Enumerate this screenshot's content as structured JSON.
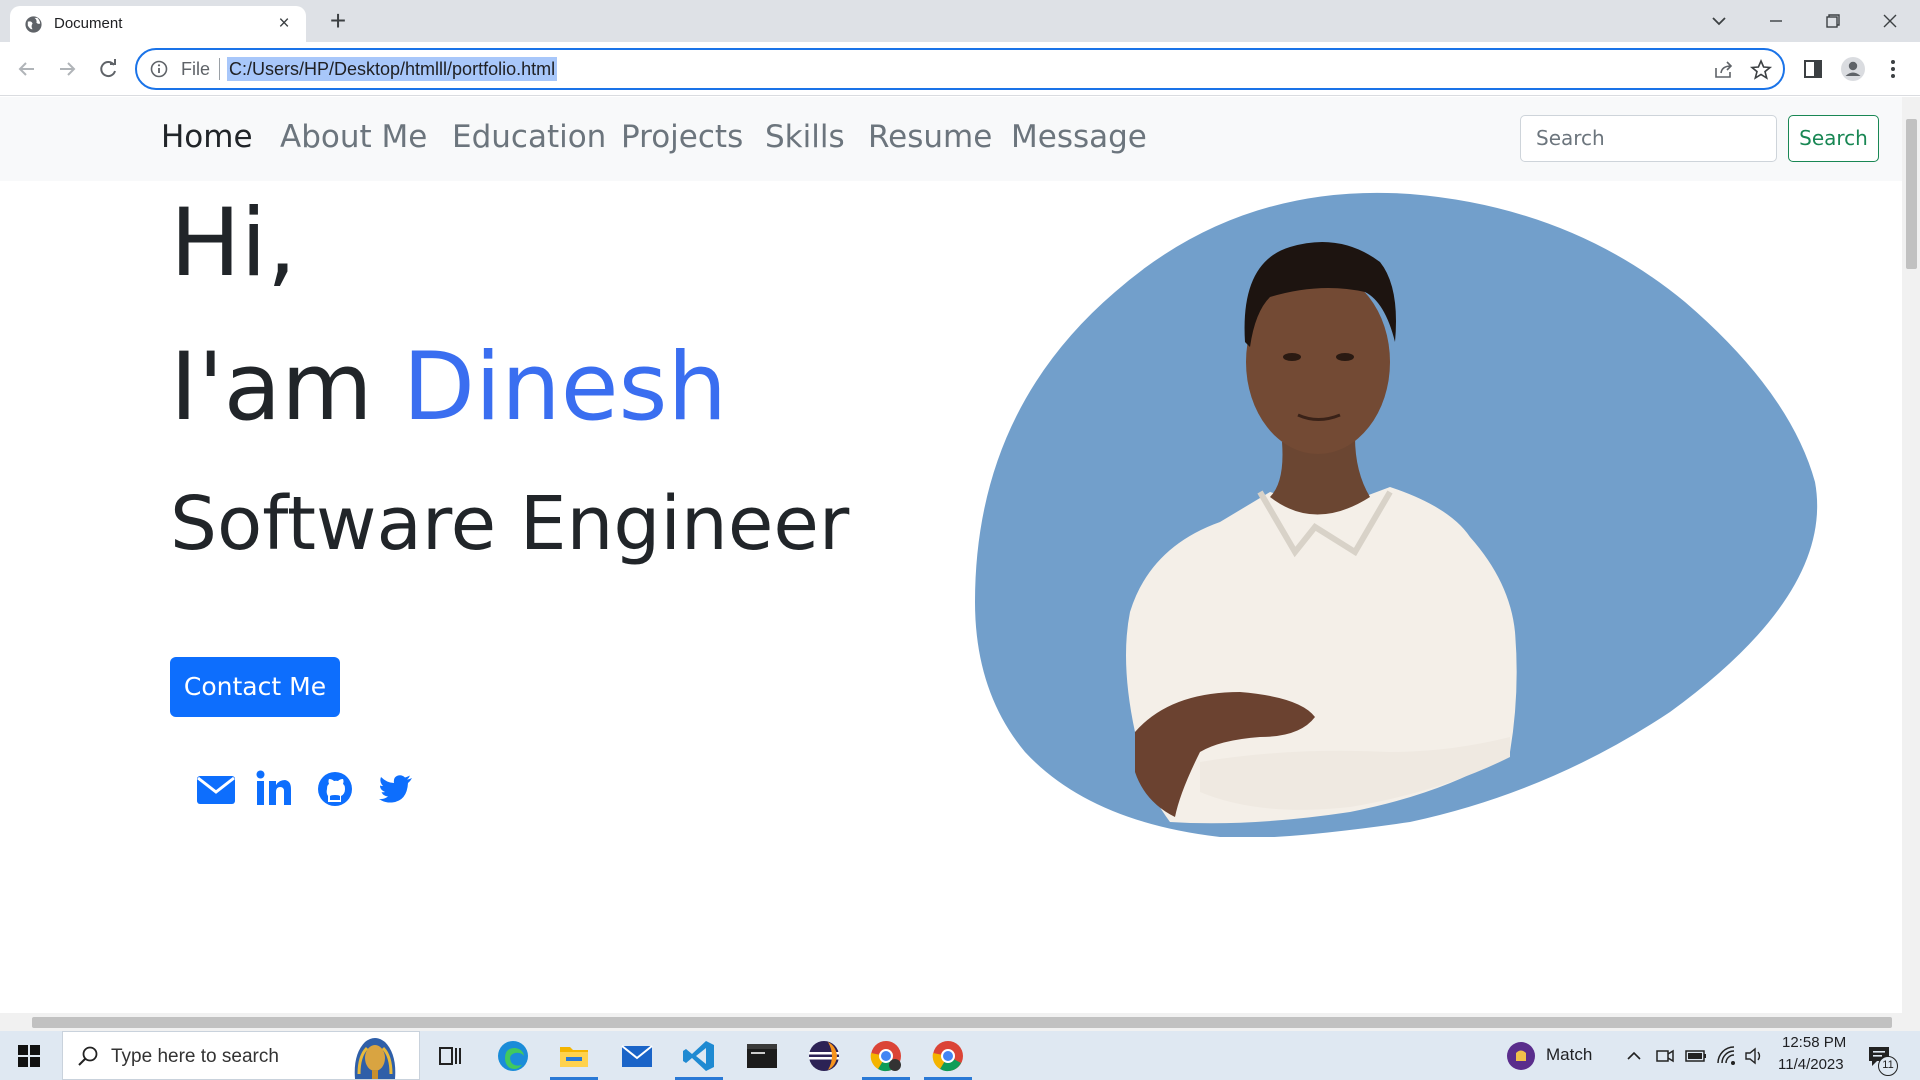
{
  "browser": {
    "tab_title": "Document",
    "new_tab": "+",
    "close": "×",
    "address_prefix": "File",
    "url": "C:/Users/HP/Desktop/htmlll/portfolio.html"
  },
  "site": {
    "nav": [
      "Home",
      "About Me",
      "Education",
      "Projects",
      "Skills",
      "Resume",
      "Message"
    ],
    "search_placeholder": "Search",
    "search_button": "Search",
    "greeting": "Hi,",
    "intro_prefix": "I'am ",
    "name": "Dinesh",
    "role": "Software Engineer",
    "contact_button": "Contact Me",
    "social": [
      "envelope-icon",
      "linkedin-icon",
      "github-icon",
      "twitter-icon"
    ],
    "accent_color": "#3a6ef0",
    "blob_color": "#729fcb"
  },
  "taskbar": {
    "search_placeholder": "Type here to search",
    "weather_label": "Match",
    "time": "12:58 PM",
    "date": "11/4/2023",
    "notifications": "11"
  }
}
